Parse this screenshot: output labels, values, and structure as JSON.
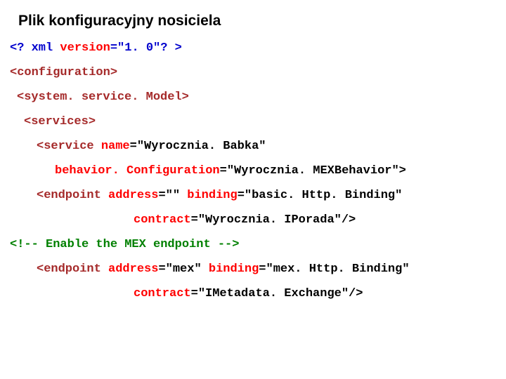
{
  "title": "Plik konfiguracyjny nosiciela",
  "code": {
    "l1": {
      "a": "<? xml ",
      "b": "version",
      "c": "=\"1. 0\"? >"
    },
    "l2": "<configuration>",
    "l3": "<system. service. Model>",
    "l4": "<services>",
    "l5": {
      "a": "<service ",
      "b": "name",
      "c": "=\"Wyrocznia. Babka\""
    },
    "l6": {
      "a": "behavior. Configuration",
      "b": "=\"Wyrocznia. MEXBehavior\">"
    },
    "l7": {
      "a": "<endpoint ",
      "b": "address",
      "c": "=\"\" ",
      "d": "binding",
      "e": "=\"basic. Http. Binding\""
    },
    "l8": {
      "a": "contract",
      "b": "=\"Wyrocznia. IPorada\"/>"
    },
    "l9": "<!-- Enable the MEX endpoint -->",
    "l10": {
      "a": "<endpoint ",
      "b": "address",
      "c": "=\"mex\" ",
      "d": "binding",
      "e": "=\"mex. Http. Binding\""
    },
    "l11": {
      "a": "contract",
      "b": "=\"IMetadata. Exchange\"/>"
    }
  }
}
